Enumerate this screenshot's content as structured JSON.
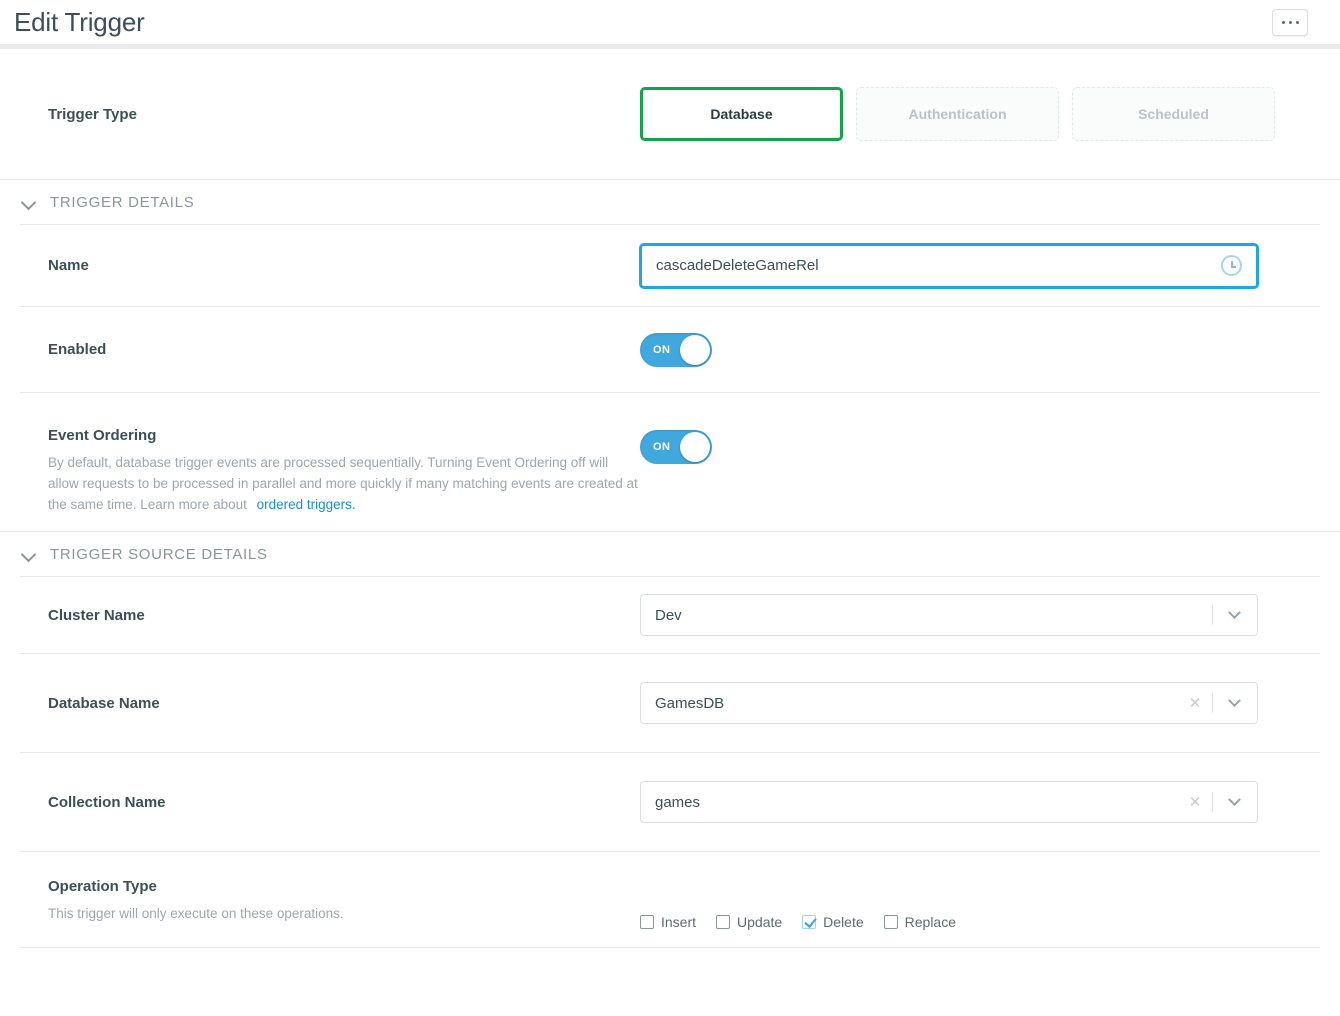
{
  "header": {
    "title": "Edit Trigger",
    "menu_button": "•••"
  },
  "trigger_type": {
    "label": "Trigger Type",
    "options": [
      {
        "label": "Database",
        "state": "selected"
      },
      {
        "label": "Authentication",
        "state": "disabled"
      },
      {
        "label": "Scheduled",
        "state": "disabled"
      }
    ]
  },
  "trigger_details": {
    "section_title": "TRIGGER DETAILS",
    "name": {
      "label": "Name",
      "value": "cascadeDeleteGameRel",
      "placeholder": "",
      "icon": "clock-icon"
    },
    "enabled": {
      "label": "Enabled",
      "toggle_text": "ON",
      "state": "on"
    },
    "event_ordering": {
      "label": "Event Ordering",
      "description": "By default, database trigger events are processed sequentially. Turning Event Ordering off will allow requests to be processed in parallel and more quickly if many matching events are created at the same time. Learn more about",
      "link_text": "ordered triggers.",
      "toggle_text": "ON",
      "state": "on"
    }
  },
  "trigger_source_details": {
    "section_title": "TRIGGER SOURCE DETAILS",
    "cluster_name": {
      "label": "Cluster Name",
      "value": "Dev"
    },
    "database_name": {
      "label": "Database Name",
      "value": "GamesDB",
      "clear_icon": "✕"
    },
    "collection_name": {
      "label": "Collection Name",
      "value": "games",
      "clear_icon": "✕"
    },
    "operation_type": {
      "label": "Operation Type",
      "description": "This trigger will only execute on these operations.",
      "options": [
        {
          "label": "Insert",
          "checked": false
        },
        {
          "label": "Update",
          "checked": false
        },
        {
          "label": "Delete",
          "checked": true
        },
        {
          "label": "Replace",
          "checked": false
        }
      ]
    }
  },
  "colors": {
    "accent_green": "#13a34a",
    "accent_blue": "#1ea7e8",
    "toggle_blue": "#41a8dd",
    "link_blue": "#1a8fd9",
    "text": "#3d4f58",
    "muted": "#9fa7ad"
  }
}
